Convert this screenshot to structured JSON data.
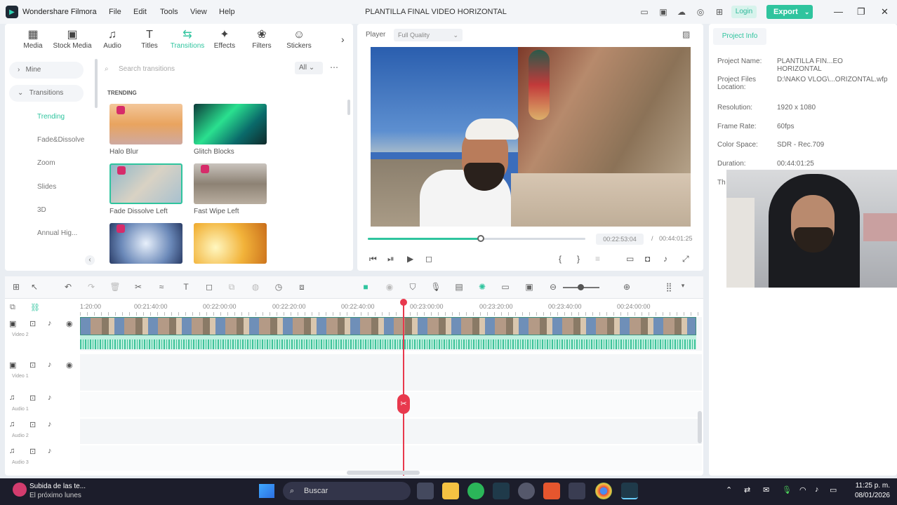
{
  "app": {
    "name": "Wondershare Filmora",
    "window_title": "PLANTILLA FINAL VIDEO HORIZONTAL"
  },
  "menu": [
    "File",
    "Edit",
    "Tools",
    "View",
    "Help"
  ],
  "titlebar": {
    "login": "Login",
    "export": "Export"
  },
  "media_tabs": [
    "Media",
    "Stock Media",
    "Audio",
    "Titles",
    "Transitions",
    "Effects",
    "Filters",
    "Stickers"
  ],
  "sidebar": {
    "mine": "Mine",
    "transitions": "Transitions",
    "items": [
      "Trending",
      "Fade&Dissolve",
      "Zoom",
      "Slides",
      "3D",
      "Annual Hig..."
    ]
  },
  "search": {
    "placeholder": "Search transitions",
    "filter": "All"
  },
  "section_label": "TRENDING",
  "transitions": [
    {
      "label": "Halo Blur"
    },
    {
      "label": "Glitch Blocks"
    },
    {
      "label": "Fade Dissolve Left"
    },
    {
      "label": "Fast Wipe Left"
    },
    {
      "label": ""
    },
    {
      "label": ""
    }
  ],
  "player": {
    "label": "Player",
    "quality": "Full Quality",
    "current_time": "00:22:53:04",
    "separator": "/",
    "total_time": "00:44:01:25",
    "progress": 0.52
  },
  "project_info": {
    "tab": "Project Info",
    "fields": [
      {
        "key": "Project Name:",
        "value": "PLANTILLA FIN...EO HORIZONTAL"
      },
      {
        "key": "Project Files Location:",
        "value": "D:\\NAKO VLOG\\...ORIZONTAL.wfp"
      },
      {
        "key": "Resolution:",
        "value": "1920 x 1080"
      },
      {
        "key": "Frame Rate:",
        "value": "60fps"
      },
      {
        "key": "Color Space:",
        "value": "SDR - Rec.709"
      },
      {
        "key": "Duration:",
        "value": "00:44:01:25"
      },
      {
        "key": "Th",
        "value": ""
      }
    ]
  },
  "timeline": {
    "ruler": [
      "1:20:00",
      "00:21:40:00",
      "00:22:00:00",
      "00:22:20:00",
      "00:22:40:00",
      "00:23:00:00",
      "00:23:20:00",
      "00:23:40:00",
      "00:24:00:00"
    ],
    "tracks": [
      "Video 2",
      "Video 1",
      "Audio 1",
      "Audio 2",
      "Audio 3"
    ]
  },
  "taskbar": {
    "notification_title": "Subida de las te...",
    "notification_sub": "El próximo lunes",
    "search": "Buscar",
    "time": "11:25 p. m.",
    "date": "08/01/2026"
  },
  "colors": {
    "accent": "#2fc49e",
    "playhead": "#e8394d",
    "taskbar": "#1c1d2b"
  }
}
